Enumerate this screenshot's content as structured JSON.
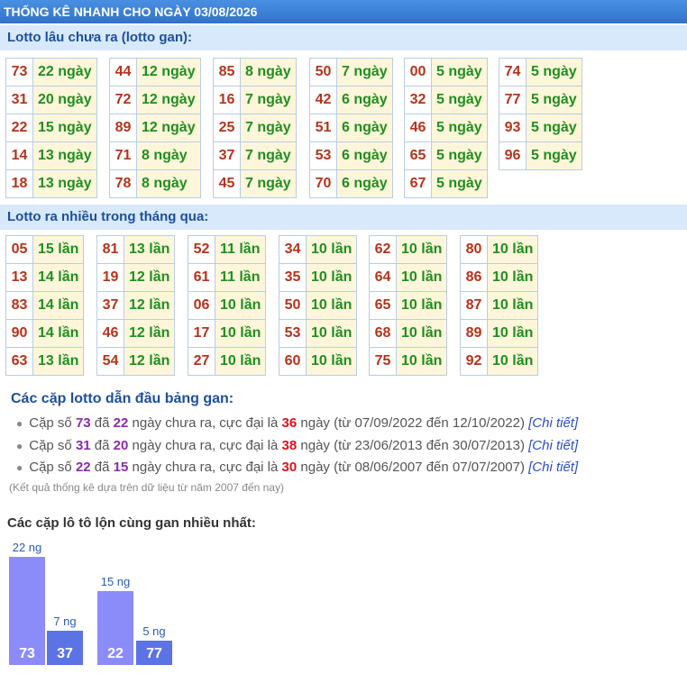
{
  "header": {
    "title": "THỐNG KÊ NHANH CHO NGÀY 03/08/2026"
  },
  "gan": {
    "title": "Lotto lâu chưa ra (lotto gan):",
    "columns": [
      [
        [
          "73",
          "22 ngày"
        ],
        [
          "31",
          "20 ngày"
        ],
        [
          "22",
          "15 ngày"
        ],
        [
          "14",
          "13 ngày"
        ],
        [
          "18",
          "13 ngày"
        ]
      ],
      [
        [
          "44",
          "12 ngày"
        ],
        [
          "72",
          "12 ngày"
        ],
        [
          "89",
          "12 ngày"
        ],
        [
          "71",
          "8 ngày"
        ],
        [
          "78",
          "8 ngày"
        ]
      ],
      [
        [
          "85",
          "8 ngày"
        ],
        [
          "16",
          "7 ngày"
        ],
        [
          "25",
          "7 ngày"
        ],
        [
          "37",
          "7 ngày"
        ],
        [
          "45",
          "7 ngày"
        ]
      ],
      [
        [
          "50",
          "7 ngày"
        ],
        [
          "42",
          "6 ngày"
        ],
        [
          "51",
          "6 ngày"
        ],
        [
          "53",
          "6 ngày"
        ],
        [
          "70",
          "6 ngày"
        ]
      ],
      [
        [
          "00",
          "5 ngày"
        ],
        [
          "32",
          "5 ngày"
        ],
        [
          "46",
          "5 ngày"
        ],
        [
          "65",
          "5 ngày"
        ],
        [
          "67",
          "5 ngày"
        ]
      ],
      [
        [
          "74",
          "5 ngày"
        ],
        [
          "77",
          "5 ngày"
        ],
        [
          "93",
          "5 ngày"
        ],
        [
          "96",
          "5 ngày"
        ]
      ]
    ]
  },
  "nhieu": {
    "title": "Lotto ra nhiều trong tháng qua:",
    "columns": [
      [
        [
          "05",
          "15 lần"
        ],
        [
          "13",
          "14 lần"
        ],
        [
          "83",
          "14 lần"
        ],
        [
          "90",
          "14 lần"
        ],
        [
          "63",
          "13 lần"
        ]
      ],
      [
        [
          "81",
          "13 lần"
        ],
        [
          "19",
          "12 lần"
        ],
        [
          "37",
          "12 lần"
        ],
        [
          "46",
          "12 lần"
        ],
        [
          "54",
          "12 lần"
        ]
      ],
      [
        [
          "52",
          "11 lần"
        ],
        [
          "61",
          "11 lần"
        ],
        [
          "06",
          "10 lần"
        ],
        [
          "17",
          "10 lần"
        ],
        [
          "27",
          "10 lần"
        ]
      ],
      [
        [
          "34",
          "10 lần"
        ],
        [
          "35",
          "10 lần"
        ],
        [
          "50",
          "10 lần"
        ],
        [
          "53",
          "10 lần"
        ],
        [
          "60",
          "10 lần"
        ]
      ],
      [
        [
          "62",
          "10 lần"
        ],
        [
          "64",
          "10 lần"
        ],
        [
          "65",
          "10 lần"
        ],
        [
          "68",
          "10 lần"
        ],
        [
          "75",
          "10 lần"
        ]
      ],
      [
        [
          "80",
          "10 lần"
        ],
        [
          "86",
          "10 lần"
        ],
        [
          "87",
          "10 lần"
        ],
        [
          "89",
          "10 lần"
        ],
        [
          "92",
          "10 lần"
        ]
      ]
    ]
  },
  "pairs": {
    "title": "Các cặp lotto dẫn đầu bảng gan:",
    "items": [
      {
        "pair": "73",
        "days": "22",
        "max": "36",
        "range": "(từ 07/09/2022 đến 12/10/2022)"
      },
      {
        "pair": "31",
        "days": "20",
        "max": "38",
        "range": "(từ 23/06/2013 đến 30/07/2013)"
      },
      {
        "pair": "22",
        "days": "15",
        "max": "30",
        "range": "(từ 08/06/2007 đến 07/07/2007)"
      }
    ],
    "text_prefix": "Cặp số",
    "text_da": "đã",
    "text_mid": "ngày chưa ra, cực đại là",
    "text_ngay": "ngày",
    "link": "[Chi tiết]",
    "note": "(Kết quả thống kê dựa trên dữ liệu từ năm 2007 đến nay)"
  },
  "chart": {
    "title": "Các cặp lô tô lộn cùng gan nhiều nhất:",
    "colors": {
      "first": "#8b8cf9",
      "second": "#5c73e6"
    }
  },
  "chart_data": {
    "type": "bar",
    "title": "Các cặp lô tô lộn cùng gan nhiều nhất:",
    "categories": [
      "73",
      "37",
      "22",
      "77"
    ],
    "values": [
      22,
      7,
      15,
      5
    ],
    "value_labels": [
      "22 ng",
      "7 ng",
      "15 ng",
      "5 ng"
    ],
    "ylim": [
      0,
      22
    ]
  }
}
